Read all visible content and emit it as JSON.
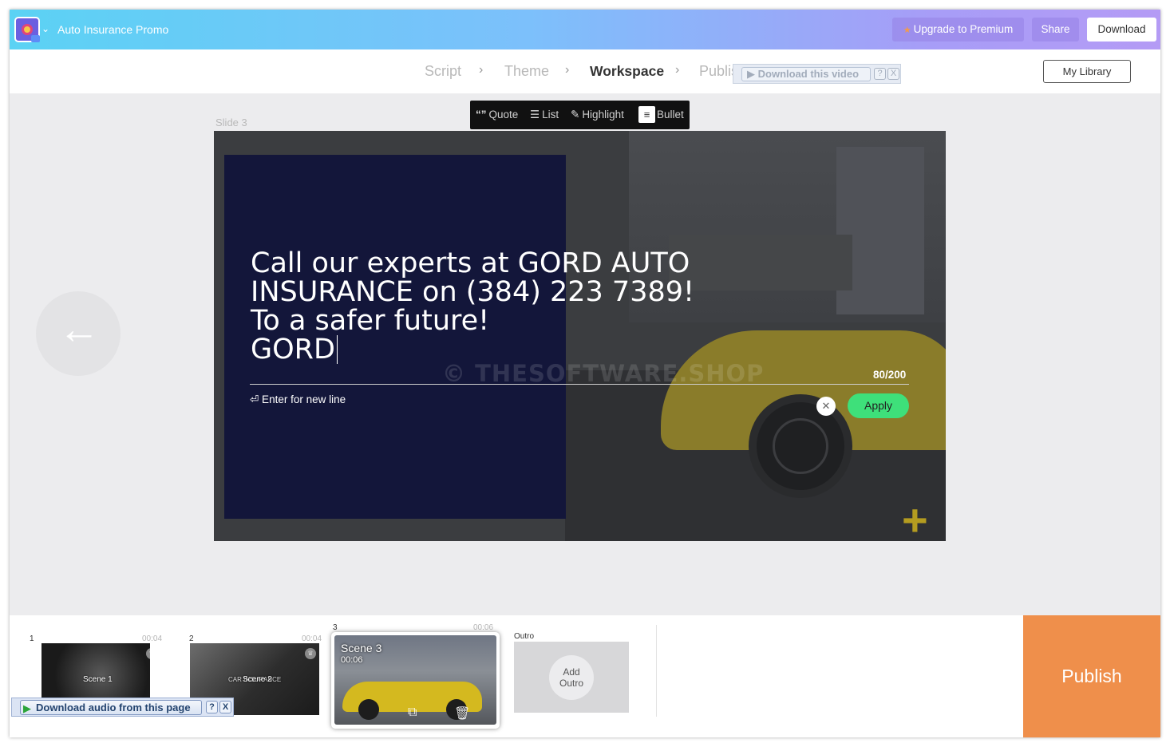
{
  "header": {
    "project_title": "Auto Insurance Promo",
    "upgrade_label": "Upgrade to Premium",
    "share_label": "Share",
    "download_label": "Download"
  },
  "steps": {
    "items": [
      "Script",
      "Theme",
      "Workspace",
      "Publish"
    ],
    "active": "Workspace",
    "my_library_label": "My Library"
  },
  "overlays": {
    "download_video_label": "Download this video",
    "download_audio_label": "Download audio from this page",
    "help_glyph": "?",
    "close_glyph": "X"
  },
  "workspace": {
    "slide_label": "Slide 3",
    "toolbar": {
      "quote_label": "Quote",
      "list_label": "List",
      "highlight_label": "Highlight",
      "bullet_label": "Bullet"
    },
    "text_lines": [
      "Call our experts at GORD AUTO",
      "INSURANCE on (384) 223 7389!",
      "To a safer future!",
      "GORD"
    ],
    "watermark": "© THESOFTWARE.SHOP",
    "char_count": "80/200",
    "enter_hint": "⏎ Enter for new line",
    "apply_label": "Apply"
  },
  "timeline": {
    "scenes": [
      {
        "number": "1",
        "duration": "00:04",
        "caption": "Scene 1"
      },
      {
        "number": "2",
        "duration": "00:04",
        "caption": "Scene 2",
        "overlay_text": "CAR INSURANCE"
      },
      {
        "number": "3",
        "duration": "00:06",
        "caption": "Scene 3",
        "card_duration": "00:06"
      }
    ],
    "outro_label": "Outro",
    "add_outro_label_1": "Add",
    "add_outro_label_2": "Outro",
    "publish_label": "Publish"
  },
  "icons": {
    "app_logo": "app-logo-icon",
    "chevron": "chevron-down-icon",
    "star": "star-icon",
    "step_arrow": "chevron-right-icon",
    "back_arrow": "arrow-left-icon",
    "quote": "quote-icon",
    "list": "list-icon",
    "highlight": "pen-icon",
    "bullet": "bullet-list-icon",
    "close": "close-icon",
    "duplicate": "duplicate-icon",
    "trash": "trash-icon",
    "crown": "crown-icon",
    "play": "play-icon"
  },
  "colors": {
    "publish": "#ef8f4b",
    "apply": "#3ee07a",
    "text_panel": "#13163a",
    "topbar_start": "#5bd2f4",
    "topbar_end": "#b49bf5"
  }
}
